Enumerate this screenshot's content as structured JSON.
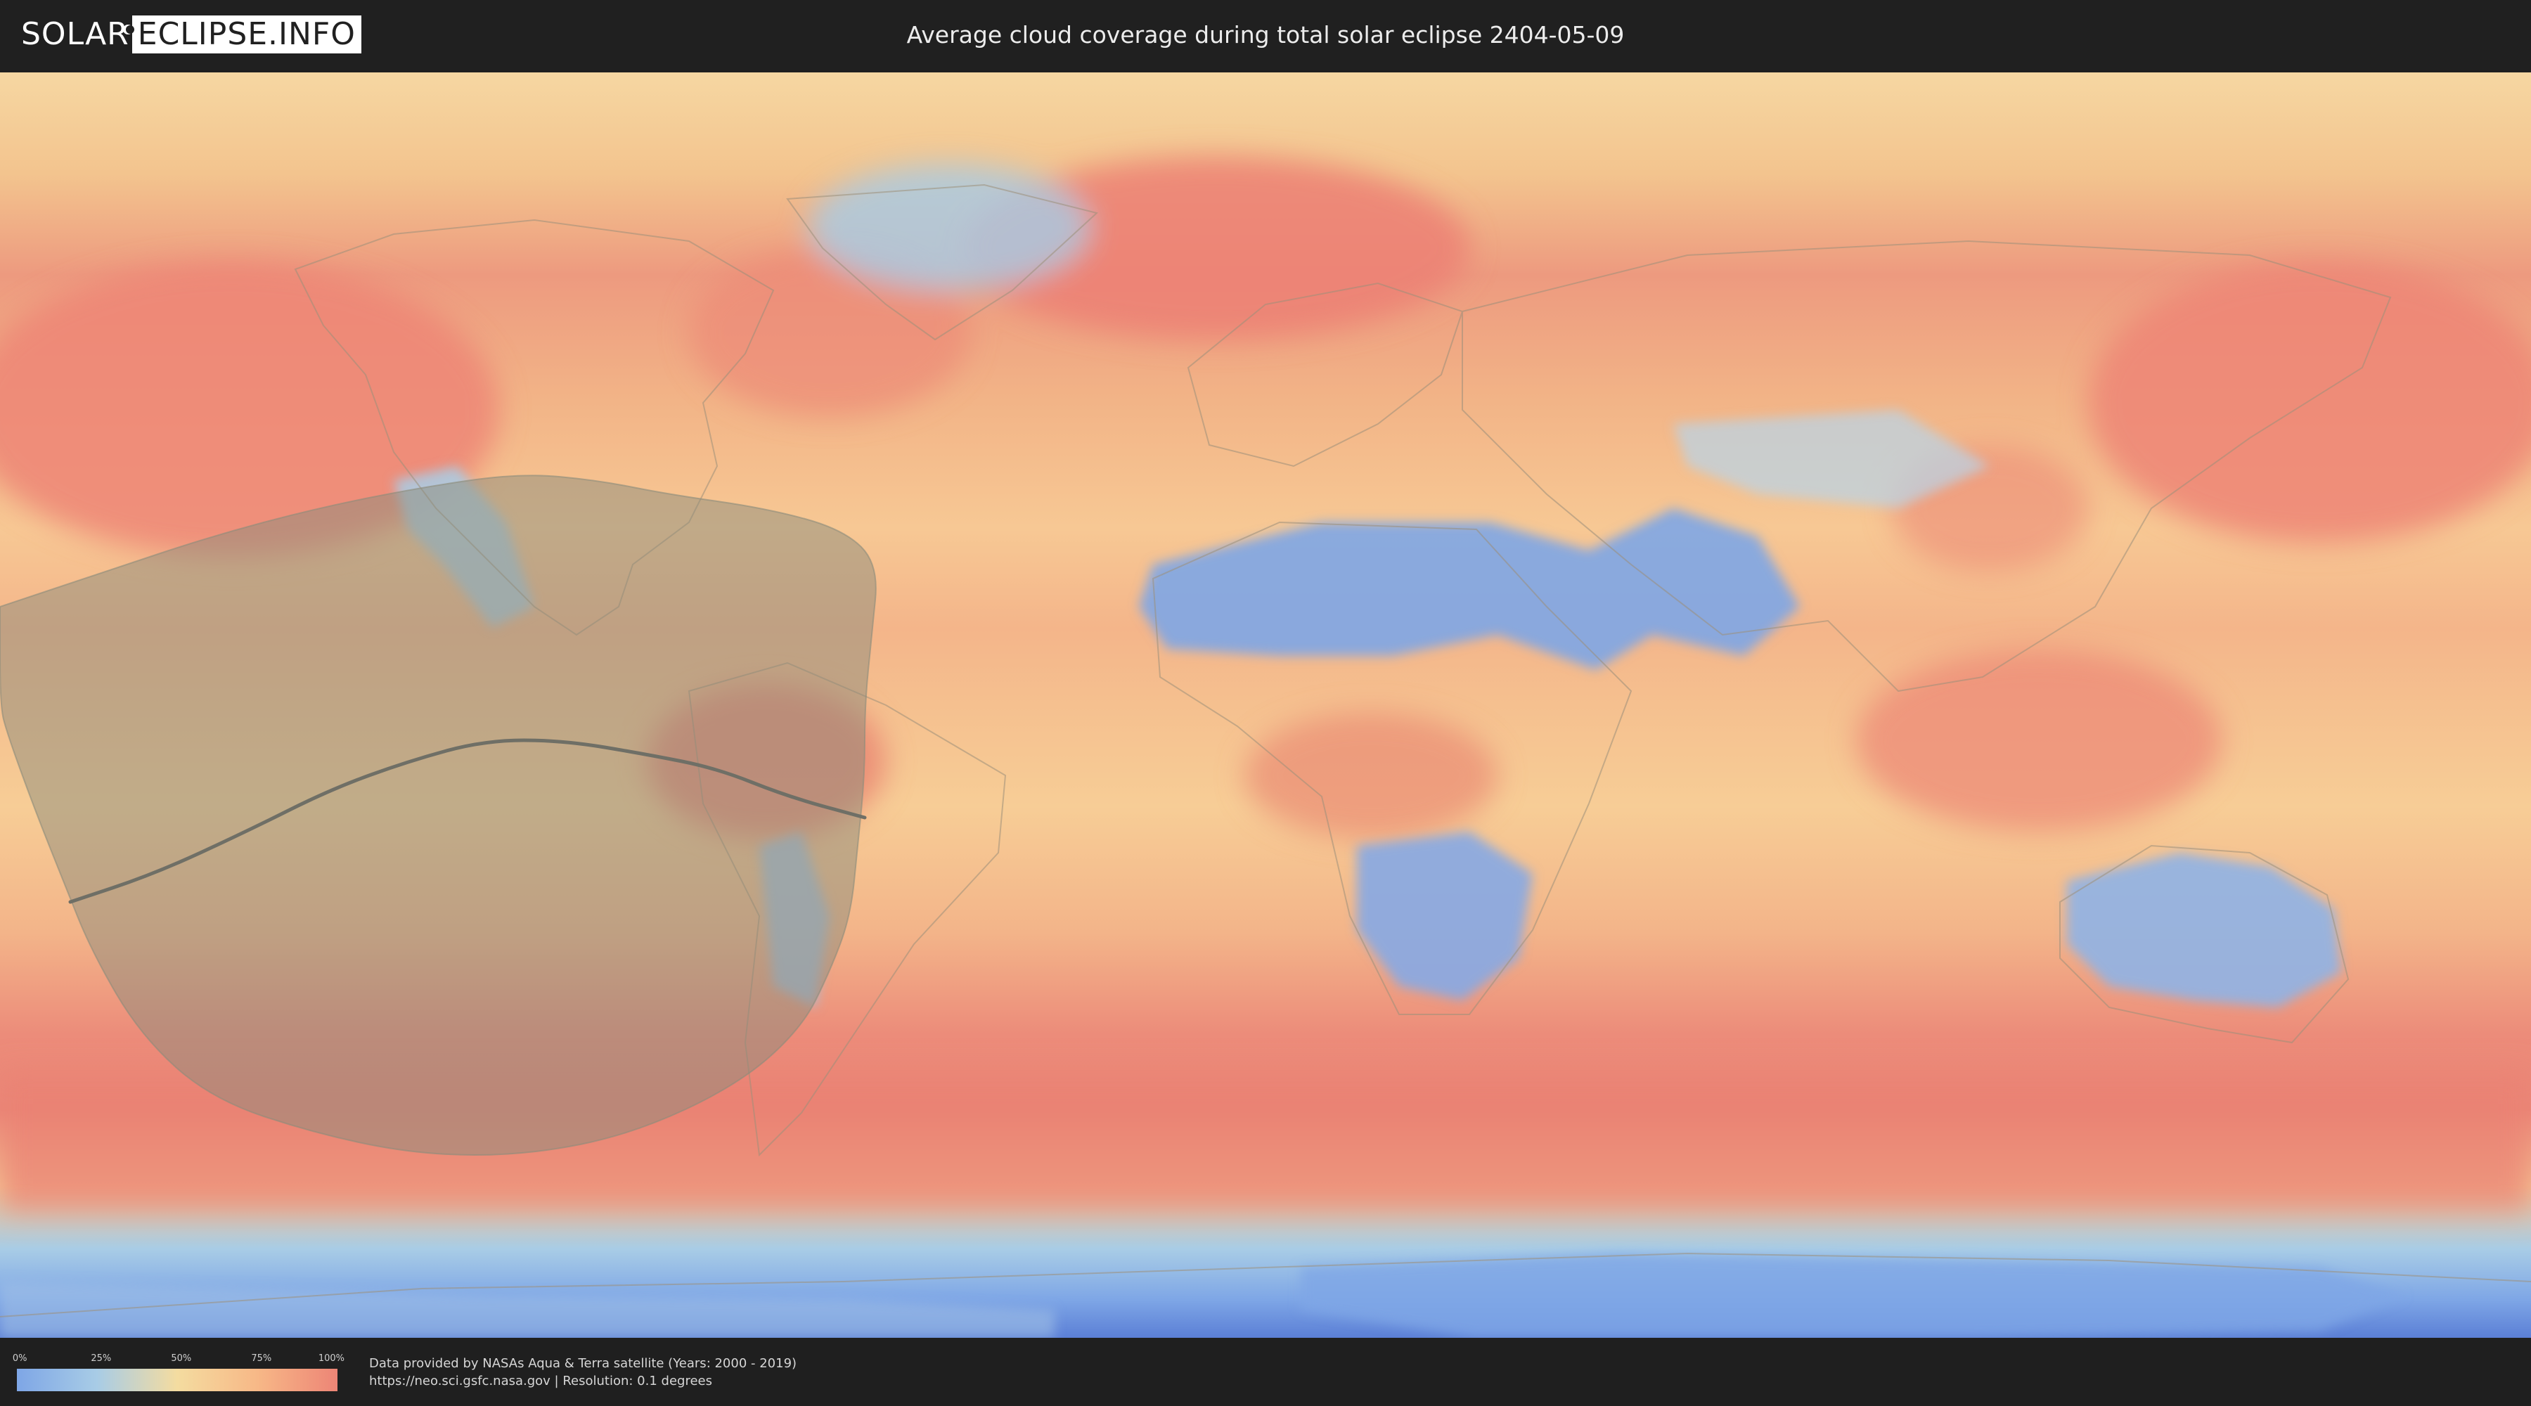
{
  "header": {
    "logo": {
      "part1": "SOLAR",
      "part2": "ECLIPSE.INFO",
      "icon": "eclipse-mark-icon"
    },
    "title": "Average cloud coverage during total solar eclipse 2404-05-09"
  },
  "map": {
    "projection": "equirectangular",
    "lon_range": [
      -180,
      180
    ],
    "lat_range": [
      -90,
      90
    ],
    "eclipse_visibility_region": {
      "fill_color": "#8c8c7c",
      "polygon_lonlat": [
        [
          -180,
          14
        ],
        [
          -165,
          19
        ],
        [
          -150,
          24
        ],
        [
          -135,
          28
        ],
        [
          -120,
          31
        ],
        [
          -106,
          33
        ],
        [
          -95,
          32
        ],
        [
          -85,
          30
        ],
        [
          -71,
          28
        ],
        [
          -60,
          25
        ],
        [
          -55,
          20
        ],
        [
          -56,
          10
        ],
        [
          -57,
          0
        ],
        [
          -57,
          -10
        ],
        [
          -58,
          -20
        ],
        [
          -59,
          -30
        ],
        [
          -62,
          -38
        ],
        [
          -66,
          -46
        ],
        [
          -75,
          -54
        ],
        [
          -90,
          -61
        ],
        [
          -105,
          -64
        ],
        [
          -120,
          -64
        ],
        [
          -135,
          -61
        ],
        [
          -150,
          -56
        ],
        [
          -160,
          -47
        ],
        [
          -167,
          -35
        ],
        [
          -171,
          -25
        ],
        [
          -175,
          -15
        ],
        [
          -179,
          -4
        ],
        [
          -180,
          0
        ],
        [
          -180,
          14
        ]
      ]
    },
    "totality_path": {
      "stroke_color": "#6f6f66",
      "points_lonlat": [
        [
          -170,
          -28
        ],
        [
          -158,
          -24
        ],
        [
          -145,
          -18
        ],
        [
          -133,
          -12
        ],
        [
          -122,
          -8
        ],
        [
          -111,
          -5
        ],
        [
          -100,
          -5
        ],
        [
          -88,
          -7
        ],
        [
          -78,
          -9
        ],
        [
          -68,
          -13
        ],
        [
          -57,
          -16
        ]
      ]
    },
    "cloud_colors": {
      "clear": "#7ea6e6",
      "low": "#a8cce6",
      "mid": "#f4dca0",
      "high": "#f7b887",
      "overcast": "#ed8576"
    }
  },
  "legend": {
    "ticks": [
      "0%",
      "25%",
      "50%",
      "75%",
      "100%"
    ],
    "gradient_colors": [
      "#7ea6e6",
      "#a8cce6",
      "#f4dca0",
      "#f7b887",
      "#ed8576"
    ]
  },
  "credits": {
    "line1": "Data provided by NASAs Aqua & Terra satellite (Years: 2000 - 2019)",
    "line2": "https://neo.sci.gsfc.nasa.gov | Resolution: 0.1 degrees"
  }
}
